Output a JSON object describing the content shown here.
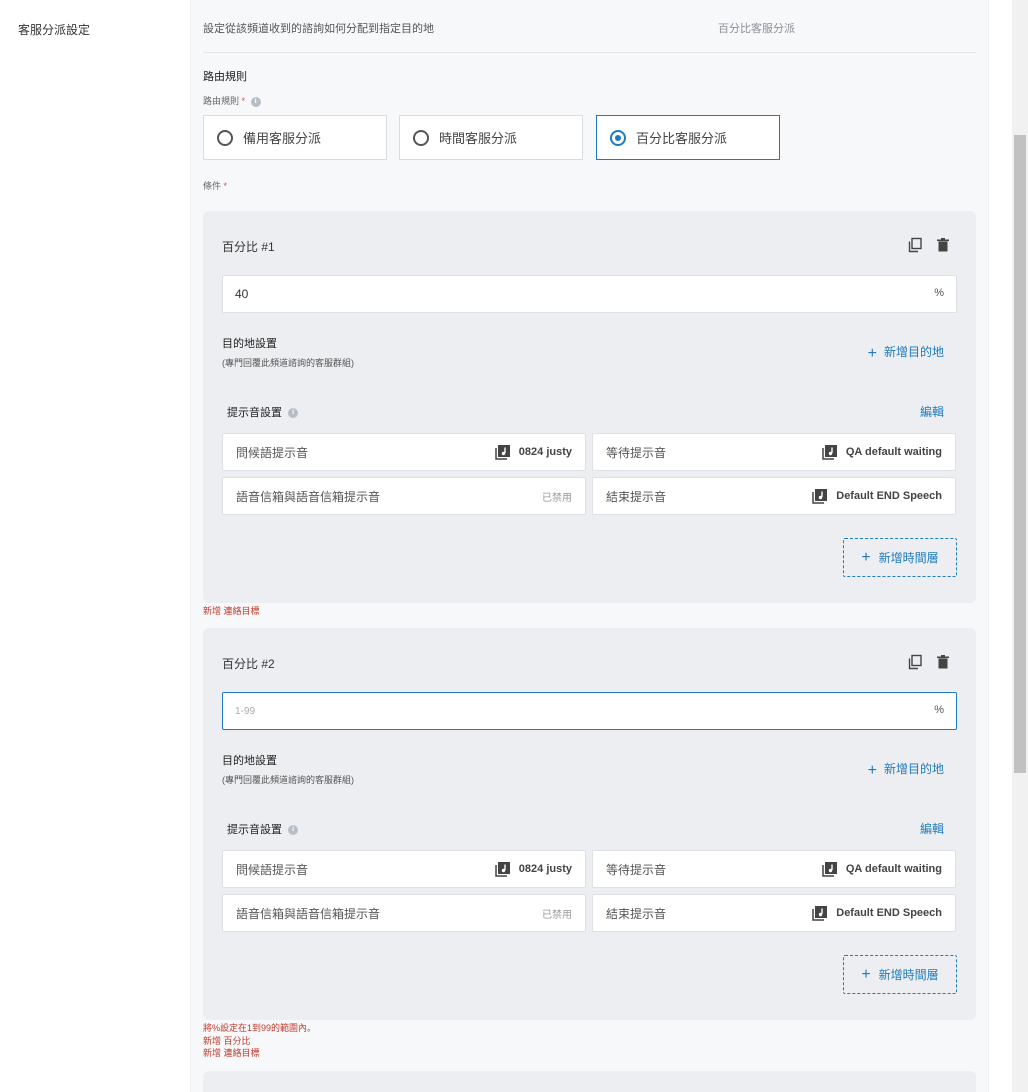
{
  "side": {
    "label": "客服分派設定"
  },
  "header": {
    "description": "設定從該頻道收到的諮詢如何分配到指定目的地",
    "mode": "百分比客服分派"
  },
  "routing": {
    "section_title": "路由規則",
    "field_label": "路由規則",
    "required_mark": "*",
    "info_icon": "i",
    "options": [
      {
        "label": "備用客服分派",
        "selected": false
      },
      {
        "label": "時間客服分派",
        "selected": false
      },
      {
        "label": "百分比客服分派",
        "selected": true
      }
    ],
    "condition_label": "條件"
  },
  "cards": [
    {
      "title": "百分比 #1",
      "percent_value": "40",
      "percent_placeholder": "",
      "suffix": "%",
      "dest_title": "目的地設置",
      "dest_sub": "(專門回覆此頻道諮詢的客服群組)",
      "add_dest": "新增目的地",
      "prompt_title": "提示音設置",
      "edit": "編輯",
      "prompts": [
        {
          "name": "問候語提示音",
          "value": "0824 justy",
          "disabled": false
        },
        {
          "name": "等待提示音",
          "value": "QA default waiting",
          "disabled": false
        },
        {
          "name": "語音信箱與語音信箱提示音",
          "value": "已禁用",
          "disabled": true
        },
        {
          "name": "結束提示音",
          "value": "Default END Speech",
          "disabled": false
        }
      ],
      "add_layer": "新增時間層"
    },
    {
      "title": "百分比 #2",
      "percent_value": "",
      "percent_placeholder": "1-99",
      "suffix": "%",
      "dest_title": "目的地設置",
      "dest_sub": "(專門回覆此頻道諮詢的客服群組)",
      "add_dest": "新增目的地",
      "prompt_title": "提示音設置",
      "edit": "編輯",
      "prompts": [
        {
          "name": "問候語提示音",
          "value": "0824 justy",
          "disabled": false
        },
        {
          "name": "等待提示音",
          "value": "QA default waiting",
          "disabled": false
        },
        {
          "name": "語音信箱與語音信箱提示音",
          "value": "已禁用",
          "disabled": true
        },
        {
          "name": "結束提示音",
          "value": "Default END Speech",
          "disabled": false
        }
      ],
      "add_layer": "新增時間層"
    }
  ],
  "errors": {
    "after_card1": [
      "新增 連絡目標"
    ],
    "after_card2": [
      "將%設定在1到99的範圍內。",
      "新增 百分比",
      "新增 連絡目標"
    ]
  },
  "icons": {
    "copy": "copy-icon",
    "delete": "trash-icon",
    "music": "music-file-icon",
    "plus": "plus-icon",
    "info": "info-icon"
  },
  "colors": {
    "accent": "#1f7bbd",
    "error": "#c0392b",
    "panel_bg": "#f7f8fa",
    "card_bg": "#eceef1"
  }
}
